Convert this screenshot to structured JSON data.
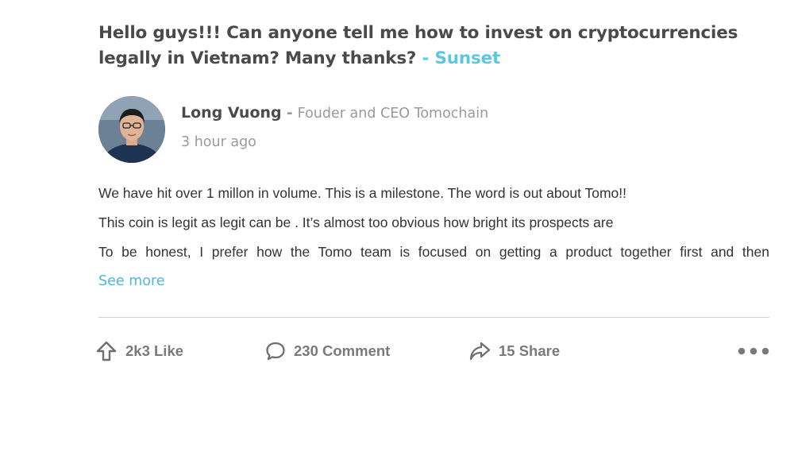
{
  "post": {
    "question": "Hello guys!!! Can anyone tell me how to invest on cryptocurrencies legally in Vietnam? Many thanks?",
    "asker": "- Sunset",
    "author": {
      "name": "Long Vuong",
      "separator": "-",
      "title": "Fouder and CEO Tomochain",
      "time": "3 hour ago",
      "avatar_icon": "person-avatar"
    },
    "body_lines": [
      "We have hit over 1 millon in volume. This is a milestone. The word is out about Tomo!!",
      "This coin is legit as legit can be .  It’s almost too obvious how bright its prospects are",
      "To be honest, I prefer how the Tomo team is focused on getting a product together first and then"
    ],
    "see_more": "See more"
  },
  "actions": {
    "like": {
      "icon": "upvote-arrow-icon",
      "label": "2k3 Like"
    },
    "comment": {
      "icon": "speech-bubble-icon",
      "label": "230 Comment"
    },
    "share": {
      "icon": "share-arrow-icon",
      "label": "15 Share"
    },
    "more": {
      "icon": "more-dots-icon"
    }
  },
  "colors": {
    "accent": "#5bc8e0",
    "text": "#4a4a4a",
    "muted": "#9a9a9a",
    "divider": "#cfcfcf"
  }
}
